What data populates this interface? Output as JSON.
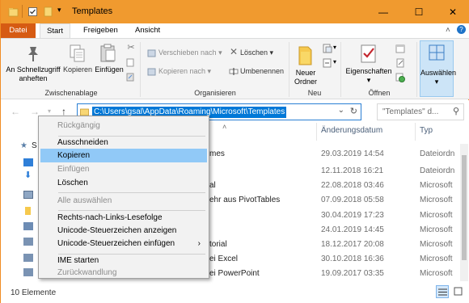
{
  "window": {
    "title": "Templates",
    "controls": {
      "minimize": "—",
      "maximize": "☐",
      "close": "✕"
    }
  },
  "tabs": {
    "file": "Datei",
    "home": "Start",
    "share": "Freigeben",
    "view": "Ansicht"
  },
  "ribbon": {
    "clipboard": {
      "pin": "An Schnellzugriff anheften",
      "pin_line1": "An Schnellzugriff",
      "pin_line2": "anheften",
      "copy": "Kopieren",
      "paste": "Einfügen",
      "label": "Zwischenablage"
    },
    "organize": {
      "move_to": "Verschieben nach",
      "copy_to": "Kopieren nach",
      "delete": "Löschen",
      "rename": "Umbenennen",
      "label": "Organisieren"
    },
    "new": {
      "new_folder_line1": "Neuer",
      "new_folder_line2": "Ordner",
      "label": "Neu"
    },
    "open": {
      "properties": "Eigenschaften",
      "label": "Öffnen"
    },
    "select": {
      "select": "Auswählen"
    }
  },
  "address": {
    "path": "C:\\Users\\gsal\\AppData\\Roaming\\Microsoft\\Templates",
    "search_placeholder": "\"Templates\" d..."
  },
  "columns": {
    "modified": "Änderungsdatum",
    "type": "Typ"
  },
  "nav_pane": {
    "first_letter": "S"
  },
  "files": [
    {
      "name_tail": "mes",
      "date": "29.03.2019 14:54",
      "type": "Dateiordn"
    },
    {
      "name_tail": "",
      "date": "12.11.2018 16:21",
      "type": "Dateiordn"
    },
    {
      "name_tail": "al",
      "date": "22.08.2018 03:46",
      "type": "Microsoft"
    },
    {
      "name_tail": "ehr aus PivotTables",
      "date": "07.09.2018 05:58",
      "type": "Microsoft"
    },
    {
      "name_tail": "",
      "date": "30.04.2019 17:23",
      "type": "Microsoft"
    },
    {
      "name_tail": "",
      "date": "24.01.2019 14:45",
      "type": "Microsoft"
    },
    {
      "name_tail": "torial",
      "date": "18.12.2017 20:08",
      "type": "Microsoft"
    },
    {
      "name_tail": "ei Excel",
      "date": "30.10.2018 16:36",
      "type": "Microsoft"
    },
    {
      "name_tail": "ei PowerPoint",
      "date": "19.09.2017 03:35",
      "type": "Microsoft"
    }
  ],
  "status": {
    "count": "10 Elemente"
  },
  "context_menu": {
    "undo": "Rückgängig",
    "cut": "Ausschneiden",
    "copy": "Kopieren",
    "paste": "Einfügen",
    "delete": "Löschen",
    "select_all": "Alle auswählen",
    "rtl": "Rechts-nach-Links-Lesefolge",
    "show_unicode": "Unicode-Steuerzeichen anzeigen",
    "insert_unicode": "Unicode-Steuerzeichen einfügen",
    "ime_start": "IME starten",
    "reconversion": "Zurückwandlung"
  },
  "colors": {
    "titlebar": "#f09a2f",
    "file_tab": "#d65b13",
    "selection": "#0078d7",
    "menu_highlight": "#91c9f7"
  }
}
